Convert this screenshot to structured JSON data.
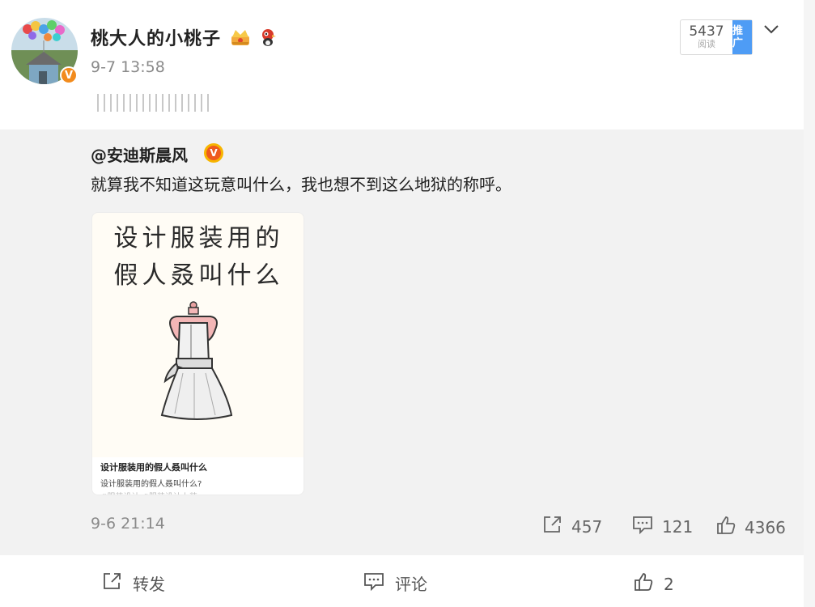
{
  "post": {
    "username": "桃大人的小桃子",
    "verified_badge": "V",
    "time": "9-7 13:58",
    "body_glyph_count": 9,
    "stats": {
      "count": "5437",
      "count_label": "阅读",
      "promote_label": "推广"
    }
  },
  "repost": {
    "author": "@安迪斯晨风",
    "verified_badge": "V",
    "text": "就算我不知道这玩意叫什么，我也想不到这么地狱的称呼。",
    "card": {
      "title_line1": "设计服装用的",
      "title_line2": "假人叒叫什么",
      "caption": "设计服装用的假人叒叫什么",
      "desc": "设计服装用的假人叒叫什么?",
      "tags": "#服装设计 #服装设计上装"
    },
    "time": "9-6 21:14",
    "repost_count": "457",
    "comment_count": "121",
    "like_count": "4366"
  },
  "actions": {
    "repost_label": "转发",
    "comment_label": "评论",
    "like_count": "2"
  },
  "colors": {
    "accent": "#f28b1d",
    "promote": "#4e9cf5",
    "repost_bg": "#f2f2f2"
  }
}
